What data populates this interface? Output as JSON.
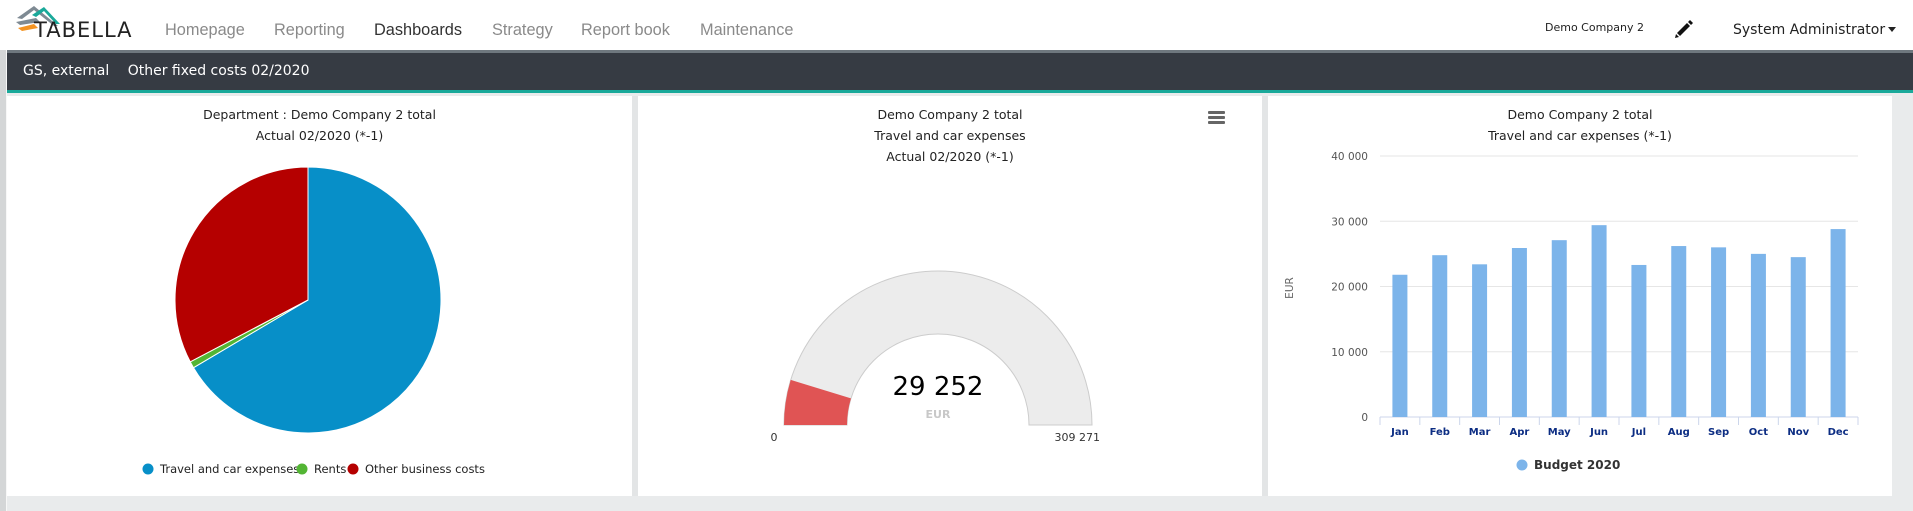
{
  "app": {
    "logo_text": "TABELLA",
    "nav": [
      {
        "label": "Homepage",
        "active": false
      },
      {
        "label": "Reporting",
        "active": false
      },
      {
        "label": "Dashboards",
        "active": true
      },
      {
        "label": "Strategy",
        "active": false
      },
      {
        "label": "Report book",
        "active": false
      },
      {
        "label": "Maintenance",
        "active": false
      }
    ],
    "company": "Demo Company 2",
    "edit_icon": "pencil-icon",
    "user": "System Administrator"
  },
  "context_bar": {
    "scope": "GS, external",
    "title": "Other fixed costs 02/2020"
  },
  "colors": {
    "accent": "#1aa99a",
    "darkbar": "#363b43",
    "travel": "#078fc8",
    "rents": "#53b534",
    "other": "#b50000",
    "gauge_fill": "#e05454",
    "gauge_bg": "#ececec",
    "bar": "#7cb4ea",
    "axis_label": "#0c2d83"
  },
  "chart_data": [
    {
      "type": "pie",
      "title": "Department : Demo Company 2 total",
      "subtitle": "Actual 02/2020 (*-1)",
      "categories": [
        "Travel and car expenses",
        "Rents",
        "Other business costs"
      ],
      "values": [
        66.5,
        0.8,
        32.7
      ],
      "value_unit": "percent (estimated)",
      "legend": "bottom-center"
    },
    {
      "type": "gauge",
      "title": "Demo Company 2 total",
      "subtitle1": "Travel and car expenses",
      "subtitle2": "Actual 02/2020 (*-1)",
      "value": 29252,
      "value_label": "29 252",
      "unit": "EUR",
      "min": 0,
      "max": 309271,
      "min_label": "0",
      "max_label": "309 271",
      "menu_icon": "hamburger-menu-icon"
    },
    {
      "type": "bar",
      "title": "Demo Company 2 total",
      "subtitle": "Travel and car expenses (*-1)",
      "categories": [
        "Jan",
        "Feb",
        "Mar",
        "Apr",
        "May",
        "Jun",
        "Jul",
        "Aug",
        "Sep",
        "Oct",
        "Nov",
        "Dec"
      ],
      "series": [
        {
          "name": "Budget 2020",
          "values": [
            21800,
            24800,
            23400,
            25900,
            27100,
            29400,
            23300,
            26200,
            26000,
            25000,
            24500,
            28800
          ]
        }
      ],
      "ylabel": "EUR",
      "xlabel": "",
      "ylim": [
        0,
        40000
      ],
      "yticks": [
        0,
        10000,
        20000,
        30000,
        40000
      ],
      "ytick_labels": [
        "0",
        "10 000",
        "20 000",
        "30 000",
        "40 000"
      ],
      "grid": true,
      "legend": "bottom-center"
    }
  ]
}
